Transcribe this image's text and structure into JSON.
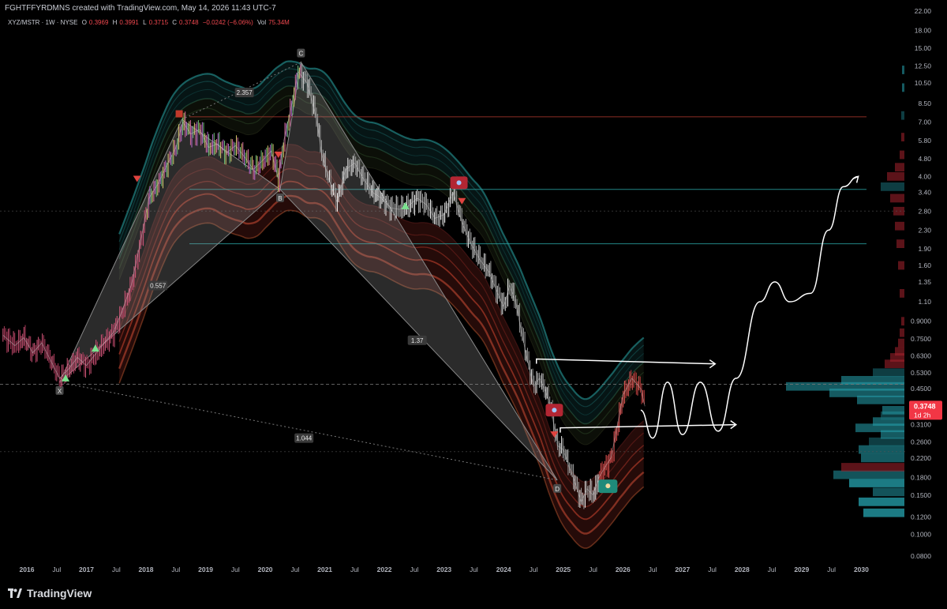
{
  "header": {
    "credit": "FGHTFFYRDMNS created with TradingView.com, May 14, 2026 11:43 UTC-7"
  },
  "symbol_line": {
    "symbol": "XYZ/MSTR · 1W · NYSE",
    "open_label": "O",
    "open_value": "0.3969",
    "high_label": "H",
    "high_value": "0.3991",
    "low_label": "L",
    "low_value": "0.3715",
    "close_label": "C",
    "close_value": "0.3748",
    "change": "−0.0242 (−6.06%)",
    "vol_label": "Vol",
    "vol_value": "75.34M"
  },
  "colors": {
    "background": "#000000",
    "up": "#26a69a",
    "down": "#ef5350",
    "price_tag": "#f23645",
    "ribbon_teal": "#2aa6a6",
    "ribbon_red": "#e0533a",
    "harmonic_fill": "#9a9a9a"
  },
  "watermark": {
    "brand": "TradingView",
    "icon": "tradingview-logo-icon"
  },
  "chart_data": {
    "type": "line",
    "title": "XYZ/MSTR · 1W · NYSE",
    "y_scale": "log",
    "ylim": [
      0.075,
      22
    ],
    "xlim": [
      2015.55,
      2030.75
    ],
    "grid": false,
    "legend": "none",
    "y_ticks": [
      "22.00",
      "18.00",
      "15.00",
      "12.50",
      "10.50",
      "8.50",
      "7.00",
      "5.80",
      "4.80",
      "4.00",
      "3.40",
      "2.80",
      "2.30",
      "1.90",
      "1.60",
      "1.35",
      "1.10",
      "0.9000",
      "0.7500",
      "0.6300",
      "0.5300",
      "0.4500",
      "0.3748",
      "0.3100",
      "0.2600",
      "0.2200",
      "0.1800",
      "0.1500",
      "0.1200",
      "0.1000",
      "0.0800"
    ],
    "x_ticks": [
      {
        "label": "2016",
        "x": 2016.0
      },
      {
        "label": "Jul",
        "x": 2016.5
      },
      {
        "label": "2017",
        "x": 2017.0
      },
      {
        "label": "Jul",
        "x": 2017.5
      },
      {
        "label": "2018",
        "x": 2018.0
      },
      {
        "label": "Jul",
        "x": 2018.5
      },
      {
        "label": "2019",
        "x": 2019.0
      },
      {
        "label": "Jul",
        "x": 2019.5
      },
      {
        "label": "2020",
        "x": 2020.0
      },
      {
        "label": "Jul",
        "x": 2020.5
      },
      {
        "label": "2021",
        "x": 2021.0
      },
      {
        "label": "Jul",
        "x": 2021.5
      },
      {
        "label": "2022",
        "x": 2022.0
      },
      {
        "label": "Jul",
        "x": 2022.5
      },
      {
        "label": "2023",
        "x": 2023.0
      },
      {
        "label": "Jul",
        "x": 2023.5
      },
      {
        "label": "2024",
        "x": 2024.0
      },
      {
        "label": "Jul",
        "x": 2024.5
      },
      {
        "label": "2025",
        "x": 2025.0
      },
      {
        "label": "Jul",
        "x": 2025.5
      },
      {
        "label": "2026",
        "x": 2026.0
      },
      {
        "label": "Jul",
        "x": 2026.5
      },
      {
        "label": "2027",
        "x": 2027.0
      },
      {
        "label": "Jul",
        "x": 2027.5
      },
      {
        "label": "2028",
        "x": 2028.0
      },
      {
        "label": "Jul",
        "x": 2028.5
      },
      {
        "label": "2029",
        "x": 2029.0
      },
      {
        "label": "Jul",
        "x": 2029.5
      },
      {
        "label": "2030",
        "x": 2030.0
      }
    ],
    "current_price": {
      "label": "0.3748",
      "countdown": "1d 2h",
      "value": 0.3748
    },
    "series": [
      {
        "values": [
          [
            2015.6,
            0.78
          ],
          [
            2015.8,
            0.7
          ],
          [
            2015.95,
            0.76
          ],
          [
            2016.1,
            0.65
          ],
          [
            2016.25,
            0.72
          ],
          [
            2016.4,
            0.6
          ],
          [
            2016.55,
            0.5
          ],
          [
            2016.7,
            0.55
          ],
          [
            2016.85,
            0.62
          ],
          [
            2017.0,
            0.57
          ],
          [
            2017.15,
            0.64
          ],
          [
            2017.3,
            0.72
          ],
          [
            2017.45,
            0.8
          ],
          [
            2017.6,
            1.0
          ],
          [
            2017.75,
            1.3
          ],
          [
            2017.9,
            2.0
          ],
          [
            2018.05,
            3.2
          ],
          [
            2018.2,
            3.7
          ],
          [
            2018.35,
            4.5
          ],
          [
            2018.5,
            5.4
          ],
          [
            2018.62,
            7.0
          ],
          [
            2018.75,
            6.2
          ],
          [
            2018.9,
            6.5
          ],
          [
            2019.05,
            5.4
          ],
          [
            2019.2,
            5.6
          ],
          [
            2019.35,
            5.1
          ],
          [
            2019.5,
            5.5
          ],
          [
            2019.65,
            4.9
          ],
          [
            2019.8,
            4.3
          ],
          [
            2019.95,
            4.7
          ],
          [
            2020.1,
            5.2
          ],
          [
            2020.22,
            3.9
          ],
          [
            2020.3,
            5.6
          ],
          [
            2020.45,
            8.5
          ],
          [
            2020.55,
            11.8
          ],
          [
            2020.7,
            10.5
          ],
          [
            2020.85,
            7.5
          ],
          [
            2020.95,
            5.0
          ],
          [
            2021.05,
            4.0
          ],
          [
            2021.2,
            3.1
          ],
          [
            2021.35,
            4.3
          ],
          [
            2021.5,
            4.6
          ],
          [
            2021.65,
            3.9
          ],
          [
            2021.8,
            3.4
          ],
          [
            2021.95,
            3.2
          ],
          [
            2022.1,
            2.9
          ],
          [
            2022.25,
            2.85
          ],
          [
            2022.4,
            2.95
          ],
          [
            2022.55,
            3.2
          ],
          [
            2022.7,
            3.0
          ],
          [
            2022.85,
            2.6
          ],
          [
            2023.0,
            2.7
          ],
          [
            2023.15,
            3.4
          ],
          [
            2023.3,
            2.5
          ],
          [
            2023.45,
            2.0
          ],
          [
            2023.6,
            1.7
          ],
          [
            2023.75,
            1.5
          ],
          [
            2023.9,
            1.2
          ],
          [
            2024.0,
            1.05
          ],
          [
            2024.1,
            1.3
          ],
          [
            2024.2,
            1.1
          ],
          [
            2024.3,
            0.8
          ],
          [
            2024.4,
            0.6
          ],
          [
            2024.5,
            0.46
          ],
          [
            2024.6,
            0.5
          ],
          [
            2024.7,
            0.44
          ],
          [
            2024.8,
            0.36
          ],
          [
            2024.9,
            0.25
          ],
          [
            2025.0,
            0.24
          ],
          [
            2025.1,
            0.2
          ],
          [
            2025.2,
            0.17
          ],
          [
            2025.3,
            0.14
          ],
          [
            2025.4,
            0.16
          ],
          [
            2025.5,
            0.15
          ],
          [
            2025.6,
            0.18
          ],
          [
            2025.7,
            0.2
          ],
          [
            2025.8,
            0.22
          ],
          [
            2025.9,
            0.3
          ],
          [
            2026.0,
            0.42
          ],
          [
            2026.15,
            0.5
          ],
          [
            2026.3,
            0.45
          ],
          [
            2026.37,
            0.3748
          ]
        ]
      }
    ],
    "reference_lines": [
      {
        "value": 7.4,
        "color": "#b03a2e"
      },
      {
        "value": 3.5,
        "color": "#2aa6a6"
      },
      {
        "value": 2.0,
        "color": "#2aa6a6"
      },
      {
        "value": 0.47,
        "color": "#777777",
        "style": "dashed"
      }
    ],
    "harmonic_pattern": {
      "points": [
        {
          "label": "X",
          "x": 2016.55,
          "y": 0.48
        },
        {
          "label": "A",
          "x": 2018.6,
          "y": 7.2
        },
        {
          "label": "B",
          "x": 2020.25,
          "y": 3.5
        },
        {
          "label": "C",
          "x": 2020.6,
          "y": 13.0
        },
        {
          "label": "D",
          "x": 2024.9,
          "y": 0.175
        }
      ],
      "ratios": [
        {
          "label": "0.557",
          "x": 2018.2,
          "y": 1.3
        },
        {
          "label": "2.357",
          "x": 2019.65,
          "y": 9.5
        },
        {
          "label": "1.37",
          "x": 2022.55,
          "y": 0.74
        },
        {
          "label": "1.044",
          "x": 2020.65,
          "y": 0.27
        }
      ]
    },
    "annotations": [
      {
        "label": "projection-arrow-upper",
        "from": [
          2024.55,
          0.61
        ],
        "to": [
          2027.55,
          0.58
        ]
      },
      {
        "label": "projection-arrow-lower",
        "from": [
          2024.95,
          0.3
        ],
        "to": [
          2027.9,
          0.31
        ]
      }
    ]
  }
}
